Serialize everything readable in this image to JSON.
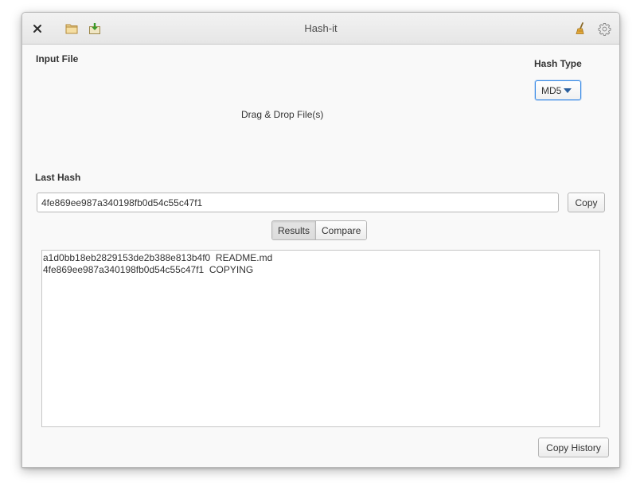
{
  "window": {
    "title": "Hash-it"
  },
  "header": {
    "close_icon": "close-icon",
    "open_icon": "folder-open-icon",
    "save_icon": "document-save-icon",
    "clear_icon": "broom-icon",
    "settings_icon": "gear-icon"
  },
  "input": {
    "label": "Input File",
    "dropzone_text": "Drag & Drop File(s)"
  },
  "hash_type": {
    "label": "Hash Type",
    "selected": "MD5"
  },
  "last_hash": {
    "label": "Last Hash",
    "value": "4fe869ee987a340198fb0d54c55c47f1",
    "copy_label": "Copy"
  },
  "view_switcher": {
    "tabs": [
      "Results",
      "Compare"
    ],
    "active": "Results"
  },
  "results": {
    "rows": [
      {
        "hash": "a1d0bb18eb2829153de2b388e813b4f0",
        "file": "README.md"
      },
      {
        "hash": "4fe869ee987a340198fb0d54c55c47f1",
        "file": "COPYING"
      }
    ]
  },
  "footer": {
    "copy_history_label": "Copy History"
  },
  "colors": {
    "accent": "#3689e6",
    "window_bg": "#f9f9f9",
    "titlebar_bg": "#e9e9e9"
  }
}
